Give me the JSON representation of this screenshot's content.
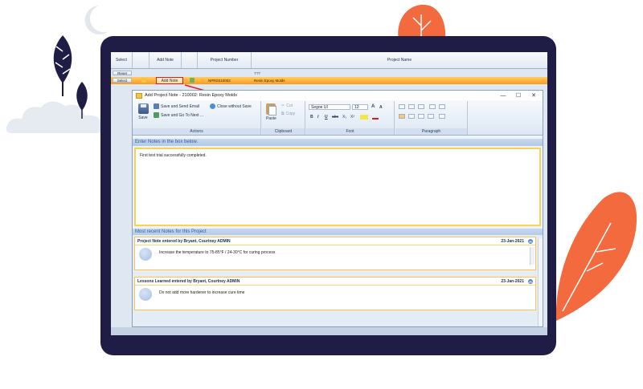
{
  "grid": {
    "headers": {
      "select": "Select",
      "add_note": "Add Note",
      "project_number": "Project Number",
      "project_name": "Project Name"
    },
    "row1": {
      "reset_label": "Reset",
      "cell_text": "TTT"
    },
    "row2": {
      "select_label": "Select",
      "add_note_label": "Add Note",
      "project_number": "NPRD210002",
      "project_name": "Resin Epoxy Molds"
    }
  },
  "dialog": {
    "title": "Add Project Note - 210002: Resin Epoxy Molds",
    "window_controls": {
      "minimize": "—",
      "maximize": "☐",
      "close": "✕"
    },
    "ribbon": {
      "actions": {
        "save_label": "Save",
        "save_send_email": "Save and Send Email",
        "close_without_save": "Close without Save",
        "save_go_next": "Save and Go To Next ...",
        "group_label": "Actions"
      },
      "clipboard": {
        "paste_label": "Paste",
        "cut_label": "Cut",
        "copy_label": "Copy",
        "group_label": "Clipboard"
      },
      "font": {
        "font_name": "Segoe UI",
        "font_size": "12",
        "bold": "B",
        "italic": "I",
        "underline": "U",
        "strike": "abc",
        "subscript": "X₂",
        "superscript": "X²",
        "grow": "A",
        "shrink": "A",
        "group_label": "Font"
      },
      "paragraph": {
        "group_label": "Paragraph"
      }
    },
    "editor": {
      "heading": "Enter Notes in the box below.",
      "text": "First test trial successfully completed."
    },
    "recent": {
      "heading": "Most recent Notes for this Project",
      "notes": [
        {
          "title": "Project Note entered by Bryant, Courtney ADMIN",
          "date": "23-Jan-2021",
          "text": "Increase the temperature to  75-85°F / 24-30°C for curing process"
        },
        {
          "title": "Lessons Learned entered by Bryant, Courtney ADMIN",
          "date": "23-Jan-2021",
          "text": "Do not add more hardener to increase cure time"
        }
      ]
    }
  },
  "colors": {
    "monitor_frame": "#1f1d45",
    "accent_orange": "#ff9a1a",
    "highlight_red": "#e01b1b",
    "leaf_orange": "#f26a3d",
    "leaf_dark": "#1f1d45"
  }
}
